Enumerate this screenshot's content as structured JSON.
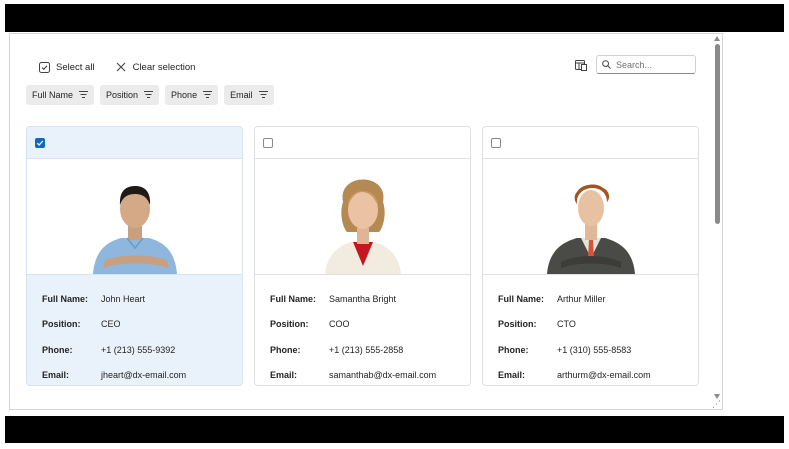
{
  "toolbar": {
    "select_all": "Select all",
    "clear_selection": "Clear selection"
  },
  "search": {
    "placeholder": "Search..."
  },
  "columns": [
    "Full Name",
    "Position",
    "Phone",
    "Email"
  ],
  "labels": {
    "full_name": "Full Name:",
    "position": "Position:",
    "phone": "Phone:",
    "email": "Email:"
  },
  "cards": [
    {
      "selected": true,
      "full_name": "John Heart",
      "position": "CEO",
      "phone": "+1 (213) 555-9392",
      "email": "jheart@dx-email.com"
    },
    {
      "selected": false,
      "full_name": "Samantha Bright",
      "position": "COO",
      "phone": "+1 (213) 555-2858",
      "email": "samanthab@dx-email.com"
    },
    {
      "selected": false,
      "full_name": "Arthur Miller",
      "position": "CTO",
      "phone": "+1 (310) 555-8583",
      "email": "arthurm@dx-email.com"
    }
  ],
  "colors": {
    "accent": "#0f6cbd",
    "selected_bg": "#e9f1fb"
  }
}
